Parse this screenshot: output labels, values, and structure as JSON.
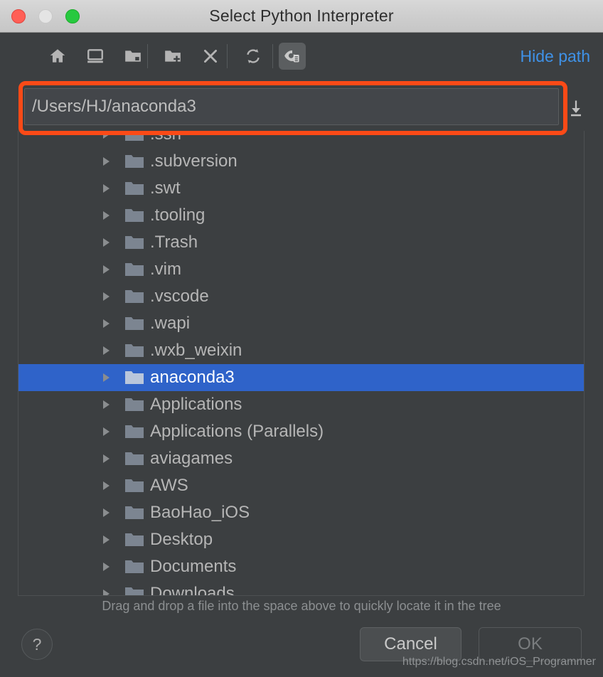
{
  "window": {
    "title": "Select Python Interpreter",
    "traffic_lights": [
      {
        "name": "close",
        "color": "#ff5f56"
      },
      {
        "name": "minimize",
        "color": "#e4e4e4"
      },
      {
        "name": "maximize",
        "color": "#27c93f"
      }
    ]
  },
  "toolbar": {
    "buttons": [
      {
        "icon": "home-icon",
        "tooltip": "Home"
      },
      {
        "icon": "desktop-icon",
        "tooltip": "Desktop"
      },
      {
        "icon": "project-folder-icon",
        "tooltip": "Project Directory"
      },
      {
        "icon": "new-folder-icon",
        "tooltip": "New Folder"
      },
      {
        "icon": "delete-icon",
        "tooltip": "Delete"
      },
      {
        "icon": "refresh-icon",
        "tooltip": "Refresh"
      },
      {
        "icon": "show-hidden-files-icon",
        "tooltip": "Show Hidden Files and Directories"
      }
    ],
    "hide_path_label": "Hide path"
  },
  "path": {
    "value": "/Users/HJ/anaconda3",
    "placeholder": "",
    "download_icon": "download-icon"
  },
  "annotation": {
    "color": "#fb4a17"
  },
  "tree": {
    "selection_color": "#2f63c9",
    "rows": [
      {
        "label": ".ssh",
        "selected": false,
        "clipped_top": true
      },
      {
        "label": ".subversion",
        "selected": false
      },
      {
        "label": ".swt",
        "selected": false
      },
      {
        "label": ".tooling",
        "selected": false
      },
      {
        "label": ".Trash",
        "selected": false
      },
      {
        "label": ".vim",
        "selected": false
      },
      {
        "label": ".vscode",
        "selected": false
      },
      {
        "label": ".wapi",
        "selected": false
      },
      {
        "label": ".wxb_weixin",
        "selected": false
      },
      {
        "label": "anaconda3",
        "selected": true
      },
      {
        "label": "Applications",
        "selected": false
      },
      {
        "label": "Applications (Parallels)",
        "selected": false
      },
      {
        "label": "aviagames",
        "selected": false
      },
      {
        "label": "AWS",
        "selected": false
      },
      {
        "label": "BaoHao_iOS",
        "selected": false
      },
      {
        "label": "Desktop",
        "selected": false
      },
      {
        "label": "Documents",
        "selected": false
      },
      {
        "label": "Downloads",
        "selected": false,
        "clipped_bottom": true
      }
    ]
  },
  "hint": {
    "text": "Drag and drop a file into the space above to quickly locate it in the tree"
  },
  "footer": {
    "help_label": "?",
    "cancel_label": "Cancel",
    "ok_label": "OK",
    "ok_enabled": false,
    "watermark": "https://blog.csdn.net/iOS_Programmer"
  }
}
